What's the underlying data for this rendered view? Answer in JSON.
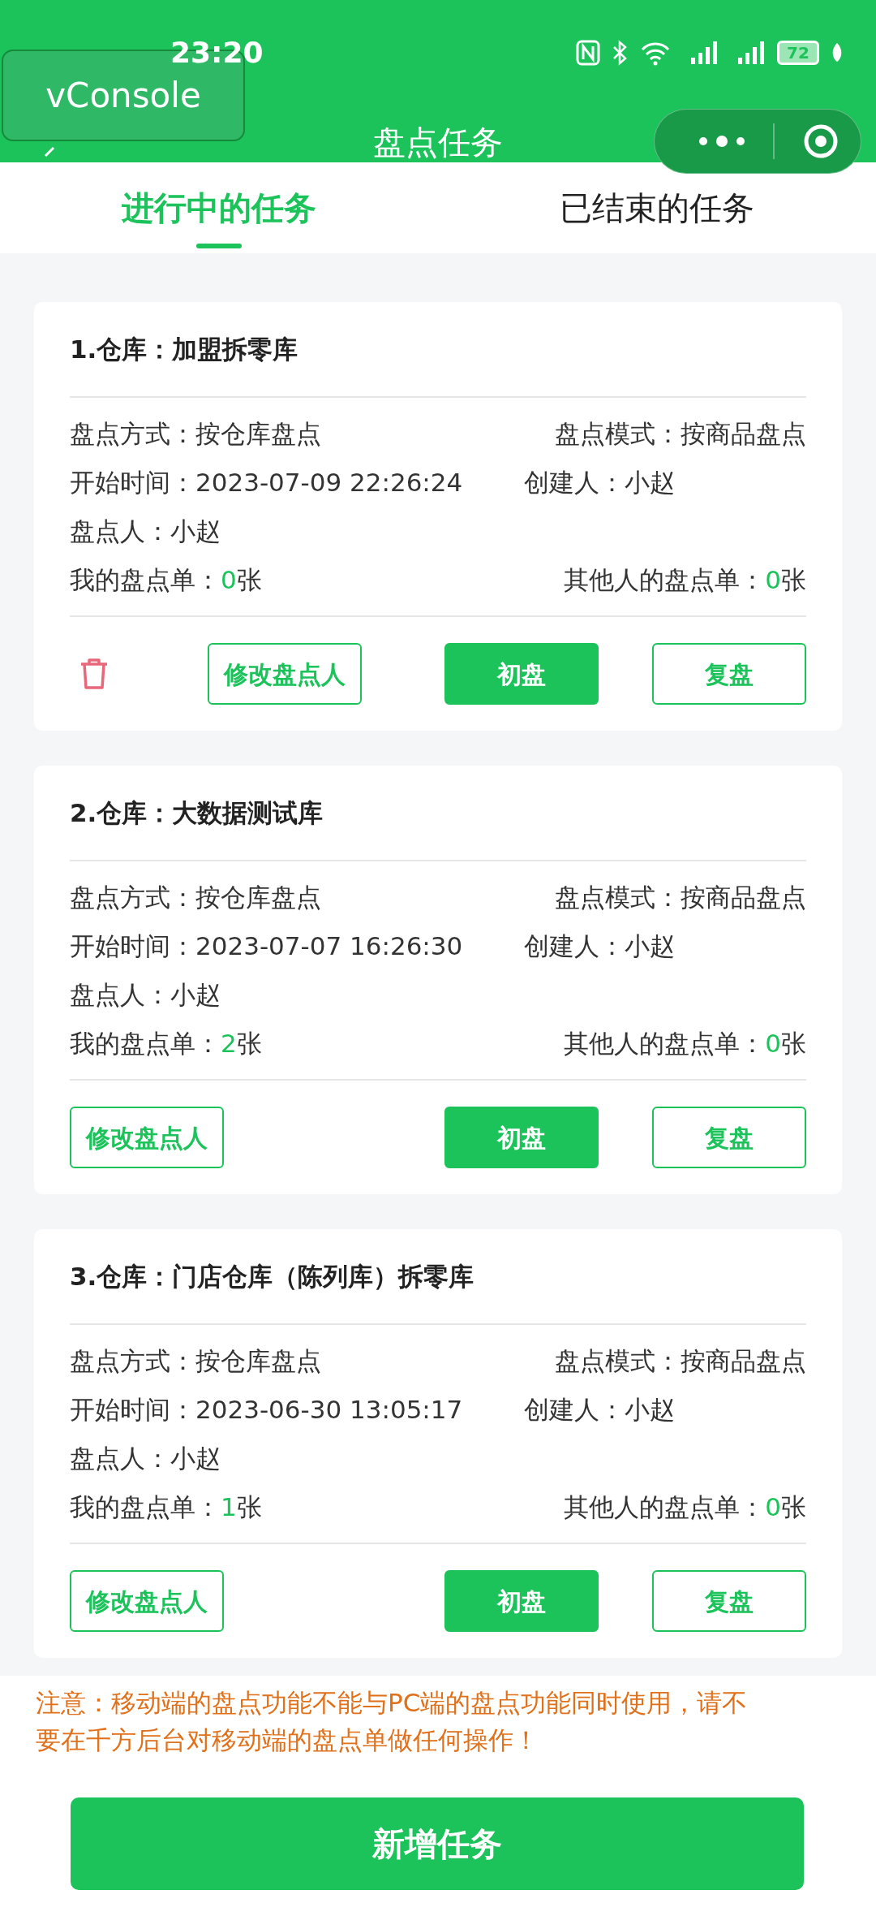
{
  "status_bar": {
    "time": "23:20",
    "battery": "72"
  },
  "vconsole": {
    "label": "vConsole"
  },
  "nav": {
    "title": "盘点任务"
  },
  "tabs": [
    {
      "label": "进行中的任务",
      "selected": true
    },
    {
      "label": "已结束的任务",
      "selected": false
    }
  ],
  "tasks": [
    {
      "title": "1.仓库：加盟拆零库",
      "method": "盘点方式：按仓库盘点",
      "mode": "盘点模式：按商品盘点",
      "start": "开始时间：2023-07-09 22:26:24",
      "creator": "创建人：小赵",
      "counter": "盘点人：小赵",
      "mine": {
        "label": "我的盘点单：",
        "count": "0",
        "unit": "张"
      },
      "others": {
        "label": "其他人的盘点单：",
        "count": "0",
        "unit": "张"
      },
      "deletable": true,
      "buttons": [
        {
          "label": "修改盘点人",
          "kind": "outline"
        },
        {
          "label": "初盘",
          "kind": "filled"
        },
        {
          "label": "复盘",
          "kind": "outline"
        }
      ]
    },
    {
      "title": "2.仓库：大数据测试库",
      "method": "盘点方式：按仓库盘点",
      "mode": "盘点模式：按商品盘点",
      "start": "开始时间：2023-07-07 16:26:30",
      "creator": "创建人：小赵",
      "counter": "盘点人：小赵",
      "mine": {
        "label": "我的盘点单：",
        "count": "2",
        "unit": "张"
      },
      "others": {
        "label": "其他人的盘点单：",
        "count": "0",
        "unit": "张"
      },
      "deletable": false,
      "buttons": [
        {
          "label": "修改盘点人",
          "kind": "outline"
        },
        {
          "label": "初盘",
          "kind": "filled"
        },
        {
          "label": "复盘",
          "kind": "outline"
        }
      ]
    },
    {
      "title": "3.仓库：门店仓库（陈列库）拆零库",
      "method": "盘点方式：按仓库盘点",
      "mode": "盘点模式：按商品盘点",
      "start": "开始时间：2023-06-30 13:05:17",
      "creator": "创建人：小赵",
      "counter": "盘点人：小赵",
      "mine": {
        "label": "我的盘点单：",
        "count": "1",
        "unit": "张"
      },
      "others": {
        "label": "其他人的盘点单：",
        "count": "0",
        "unit": "张"
      },
      "deletable": false,
      "buttons": [
        {
          "label": "修改盘点人",
          "kind": "outline"
        },
        {
          "label": "初盘",
          "kind": "filled"
        },
        {
          "label": "复盘",
          "kind": "outline"
        }
      ]
    }
  ],
  "notice": "注意：移动端的盘点功能不能与PC端的盘点功能同时使用，请不要在千方后台对移动端的盘点单做任何操作！",
  "add_button": "新增任务"
}
